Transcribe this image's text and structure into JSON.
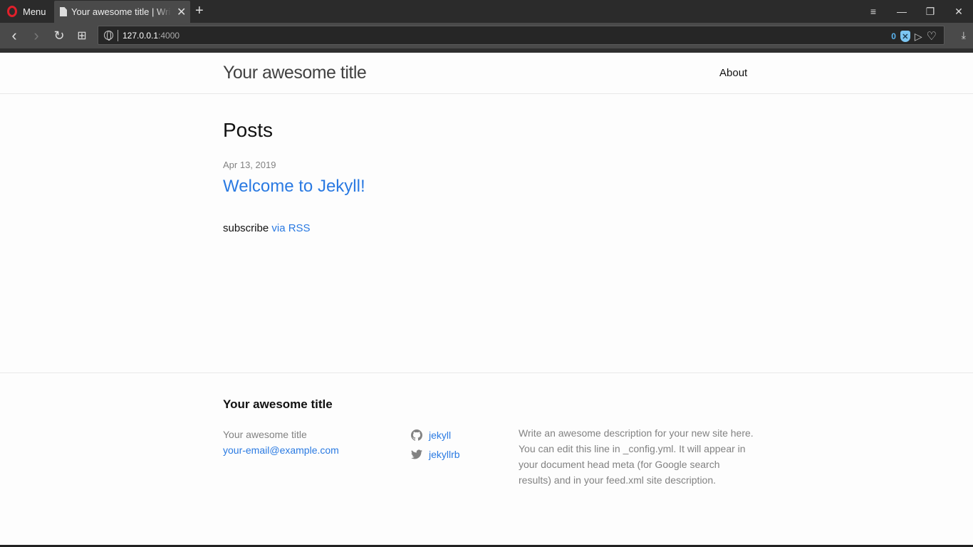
{
  "browser": {
    "menu_label": "Menu",
    "tab_title": "Your awesome title | Write an awesome description for your new site",
    "url_host": "127.0.0.1",
    "url_port": ":4000",
    "blocked_count": "0",
    "icons": {
      "back": "‹",
      "forward": "›",
      "reload": "↻",
      "speed_dial": "⊞",
      "close": "✕",
      "new_tab": "+",
      "easy_setup": "≡",
      "minimize": "—",
      "restore": "❐",
      "window_close": "✕",
      "send": "▷",
      "heart": "♡",
      "download": "⤓",
      "shield": "✕"
    }
  },
  "header": {
    "site_title": "Your awesome title",
    "nav": [
      {
        "label": "About"
      }
    ]
  },
  "main": {
    "heading": "Posts",
    "posts": [
      {
        "date": "Apr 13, 2019",
        "title": "Welcome to Jekyll!"
      }
    ],
    "subscribe_text": "subscribe ",
    "subscribe_link": "via RSS"
  },
  "footer": {
    "heading": "Your awesome title",
    "name": "Your awesome title",
    "email": "your-email@example.com",
    "social": [
      {
        "icon": "github-icon",
        "label": "jekyll"
      },
      {
        "icon": "twitter-icon",
        "label": "jekyllrb"
      }
    ],
    "description": "Write an awesome description for your new site here. You can edit this line in _config.yml. It will appear in your document head meta (for Google search results) and in your feed.xml site description."
  }
}
